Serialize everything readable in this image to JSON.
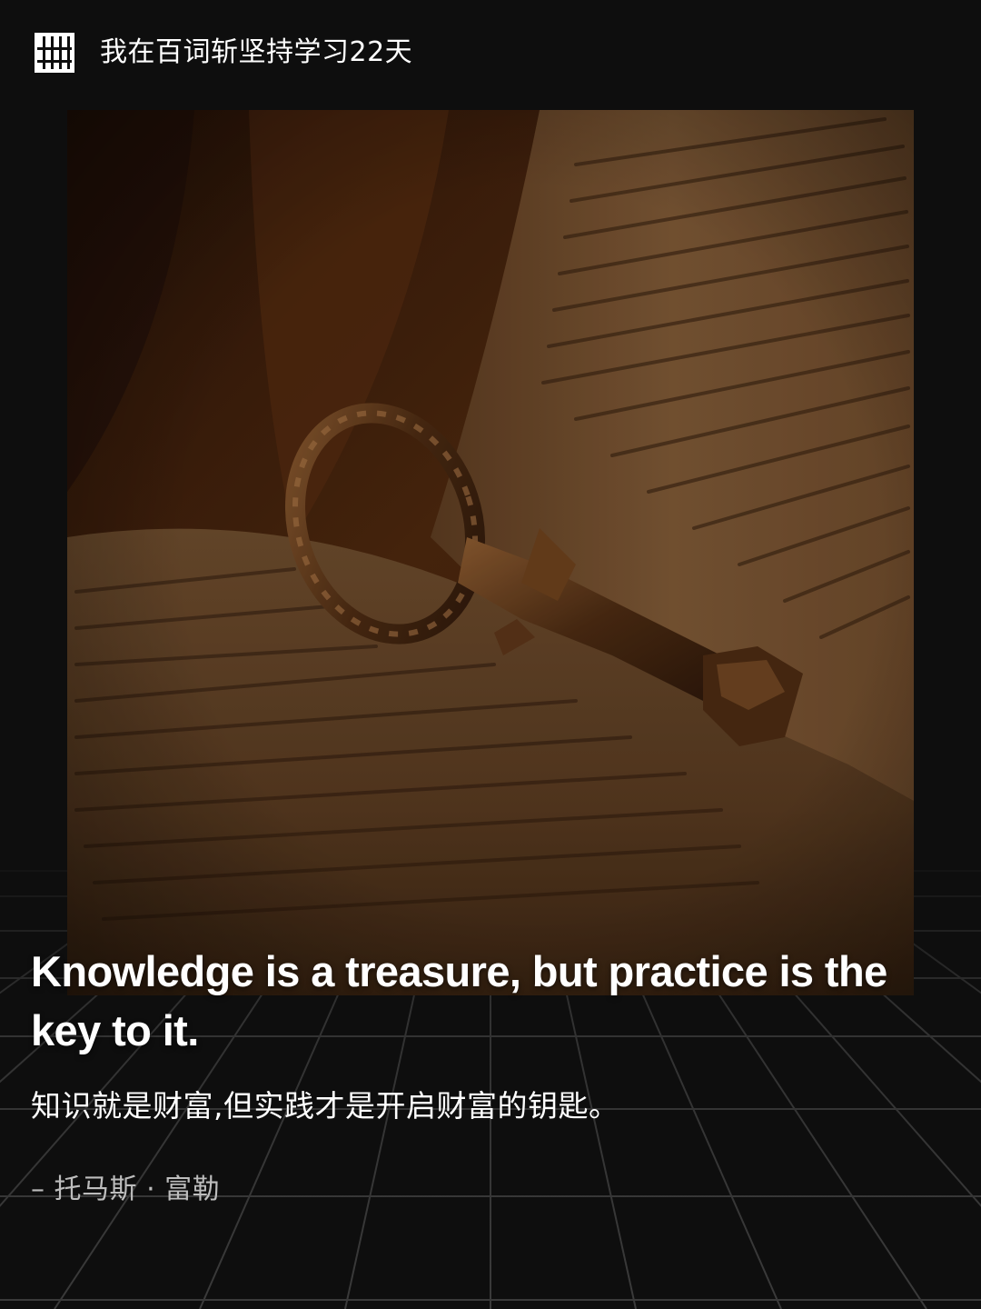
{
  "header": {
    "logo_icon": "baicizhan-logo-icon",
    "text": "我在百词斩坚持学习22天"
  },
  "image": {
    "subject": "antique-key-on-open-book-photo",
    "tone": "#3a1e0c"
  },
  "quote": {
    "english": "Knowledge is a treasure, but practice is the key to it.",
    "chinese": "知识就是财富,但实践才是开启财富的钥匙。",
    "author": "– 托马斯 · 富勒"
  },
  "colors": {
    "background": "#0e0e0e",
    "grid_line": "#3a3a3a",
    "text_primary": "#ffffff",
    "text_secondary": "#bdbdbd"
  }
}
